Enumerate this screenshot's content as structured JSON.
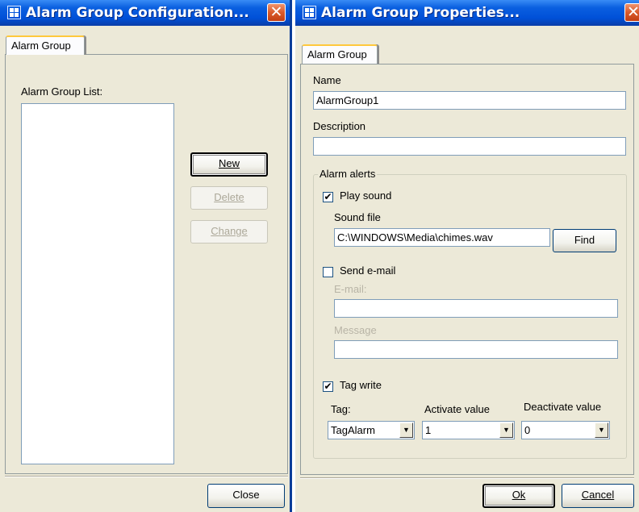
{
  "config_window": {
    "title": "Alarm Group Configuration...",
    "tab": "Alarm Group",
    "list_label": "Alarm Group List:",
    "list_items": [],
    "buttons": {
      "new": "New",
      "delete": "Delete",
      "change": "Change",
      "close": "Close"
    },
    "close_icon": "close-icon"
  },
  "properties_window": {
    "title": "Alarm Group Properties...",
    "tab": "Alarm Group",
    "name_label": "Name",
    "name_value": "AlarmGroup1",
    "description_label": "Description",
    "description_value": "",
    "alerts_group_title": "Alarm alerts",
    "play_sound": {
      "label": "Play sound",
      "checked": true
    },
    "sound_file_label": "Sound file",
    "sound_file_value": "C:\\WINDOWS\\Media\\chimes.wav",
    "find_button": "Find",
    "send_email": {
      "label": "Send e-mail",
      "checked": false
    },
    "email_label": "E-mail:",
    "email_value": "",
    "message_label": "Message",
    "message_value": "",
    "tag_write": {
      "label": "Tag write",
      "checked": true
    },
    "tag_label": "Tag:",
    "tag_value": "TagAlarm",
    "activate_label": "Activate value",
    "activate_value": "1",
    "deactivate_label": "Deactivate value",
    "deactivate_value": "0",
    "buttons": {
      "ok": "Ok",
      "cancel": "Cancel"
    },
    "check_glyph": "✔"
  },
  "colors": {
    "titlebar": "#0050d8",
    "window_bg": "#ece9d8",
    "close_button": "#d95a2b"
  }
}
